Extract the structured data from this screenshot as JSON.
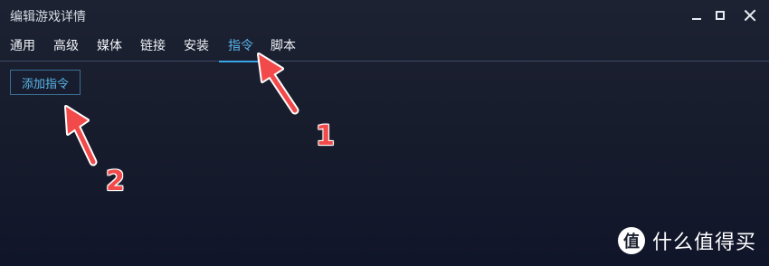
{
  "window": {
    "title": "编辑游戏详情",
    "controls": [
      "minimize-icon",
      "maximize-icon",
      "close-icon"
    ]
  },
  "tabs": [
    {
      "label": "通用"
    },
    {
      "label": "高级"
    },
    {
      "label": "媒体"
    },
    {
      "label": "链接"
    },
    {
      "label": "安装"
    },
    {
      "label": "指令",
      "active": true
    },
    {
      "label": "脚本"
    }
  ],
  "content": {
    "add_button_label": "添加指令"
  },
  "annotations": {
    "marker_1": "1",
    "marker_2": "2",
    "arrow_color": "#f24a4a"
  },
  "watermark": {
    "logo_glyph": "值",
    "text": "什么值得买"
  },
  "colors": {
    "accent": "#3aa5e8",
    "background": "#1a1f30"
  }
}
